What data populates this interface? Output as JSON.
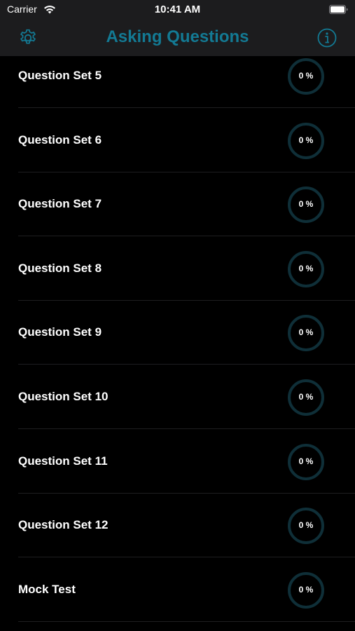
{
  "status_bar": {
    "carrier": "Carrier",
    "time": "10:41 AM",
    "wifi_icon": "wifi-icon",
    "battery_icon": "battery-icon"
  },
  "nav": {
    "title": "Asking Questions",
    "left_icon": "gear-icon",
    "right_icon": "info-icon",
    "accent_color": "#137a94"
  },
  "list": {
    "items": [
      {
        "label": "Question Set 5",
        "progress": 0,
        "progress_text": "0 %"
      },
      {
        "label": "Question Set 6",
        "progress": 0,
        "progress_text": "0 %"
      },
      {
        "label": "Question Set 7",
        "progress": 0,
        "progress_text": "0 %"
      },
      {
        "label": "Question Set 8",
        "progress": 0,
        "progress_text": "0 %"
      },
      {
        "label": "Question Set 9",
        "progress": 0,
        "progress_text": "0 %"
      },
      {
        "label": "Question Set 10",
        "progress": 0,
        "progress_text": "0 %"
      },
      {
        "label": "Question Set 11",
        "progress": 0,
        "progress_text": "0 %"
      },
      {
        "label": "Question Set 12",
        "progress": 0,
        "progress_text": "0 %"
      },
      {
        "label": "Mock Test",
        "progress": 0,
        "progress_text": "0 %"
      }
    ]
  },
  "colors": {
    "background": "#000000",
    "bar_background": "#1c1c1e",
    "progress_track": "#0f2f38",
    "progress_fill": "#137a94"
  }
}
